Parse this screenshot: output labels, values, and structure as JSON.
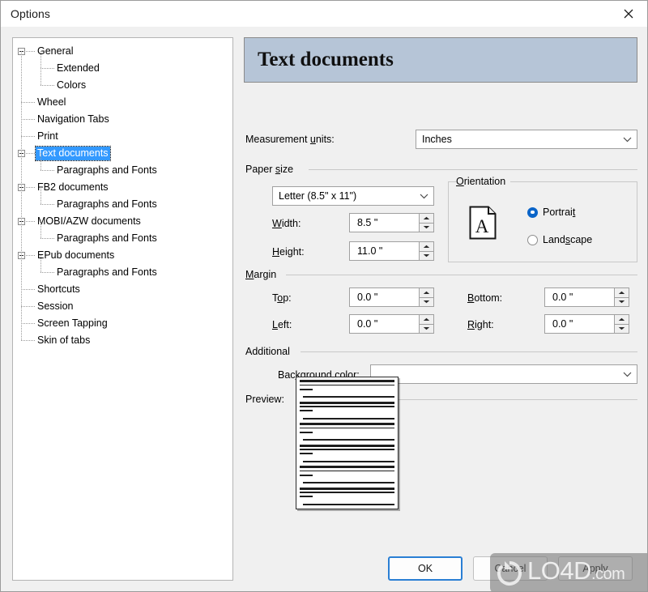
{
  "window": {
    "title": "Options",
    "close_icon": "close-icon"
  },
  "sidebar": {
    "items": [
      {
        "label": "General",
        "level": 0,
        "expander": true,
        "selected": false
      },
      {
        "label": "Extended",
        "level": 1,
        "expander": false,
        "selected": false
      },
      {
        "label": "Colors",
        "level": 1,
        "expander": false,
        "selected": false
      },
      {
        "label": "Wheel",
        "level": 0,
        "expander": false,
        "selected": false
      },
      {
        "label": "Navigation Tabs",
        "level": 0,
        "expander": false,
        "selected": false
      },
      {
        "label": "Print",
        "level": 0,
        "expander": false,
        "selected": false
      },
      {
        "label": "Text documents",
        "level": 0,
        "expander": true,
        "selected": true
      },
      {
        "label": "Paragraphs and Fonts",
        "level": 1,
        "expander": false,
        "selected": false
      },
      {
        "label": "FB2 documents",
        "level": 0,
        "expander": true,
        "selected": false
      },
      {
        "label": "Paragraphs and Fonts",
        "level": 1,
        "expander": false,
        "selected": false
      },
      {
        "label": "MOBI/AZW documents",
        "level": 0,
        "expander": true,
        "selected": false
      },
      {
        "label": "Paragraphs and Fonts",
        "level": 1,
        "expander": false,
        "selected": false
      },
      {
        "label": "EPub documents",
        "level": 0,
        "expander": true,
        "selected": false
      },
      {
        "label": "Paragraphs and Fonts",
        "level": 1,
        "expander": false,
        "selected": false
      },
      {
        "label": "Shortcuts",
        "level": 0,
        "expander": false,
        "selected": false
      },
      {
        "label": "Session",
        "level": 0,
        "expander": false,
        "selected": false
      },
      {
        "label": "Screen Tapping",
        "level": 0,
        "expander": false,
        "selected": false
      },
      {
        "label": "Skin of tabs",
        "level": 0,
        "expander": false,
        "selected": false
      }
    ]
  },
  "page": {
    "header_title": "Text documents",
    "measurement_units": {
      "label": "Measurement units:",
      "value": "Inches"
    },
    "paper_size": {
      "group_label": "Paper size",
      "preset": "Letter (8.5\" x 11\")",
      "width_label": "Width:",
      "width_value": "8.5 \"",
      "height_label": "Height:",
      "height_value": "11.0 \""
    },
    "orientation": {
      "group_label": "Orientation",
      "icon": "page-portrait-a-icon",
      "options": [
        {
          "label": "Portrait",
          "selected": true
        },
        {
          "label": "Landscape",
          "selected": false
        }
      ]
    },
    "margin": {
      "group_label": "Margin",
      "top_label": "Top:",
      "top_value": "0.0 \"",
      "bottom_label": "Bottom:",
      "bottom_value": "0.0 \"",
      "left_label": "Left:",
      "left_value": "0.0 \"",
      "right_label": "Right:",
      "right_value": "0.0 \""
    },
    "additional": {
      "group_label": "Additional",
      "background_color_label": "Background color:",
      "background_color_value": "",
      "background_color_hex": "#ffffff"
    },
    "preview": {
      "group_label": "Preview:"
    }
  },
  "footer": {
    "ok": "OK",
    "cancel": "Cancel",
    "apply": "Apply"
  },
  "watermark": {
    "text": "LO4D",
    "suffix": ".com"
  }
}
